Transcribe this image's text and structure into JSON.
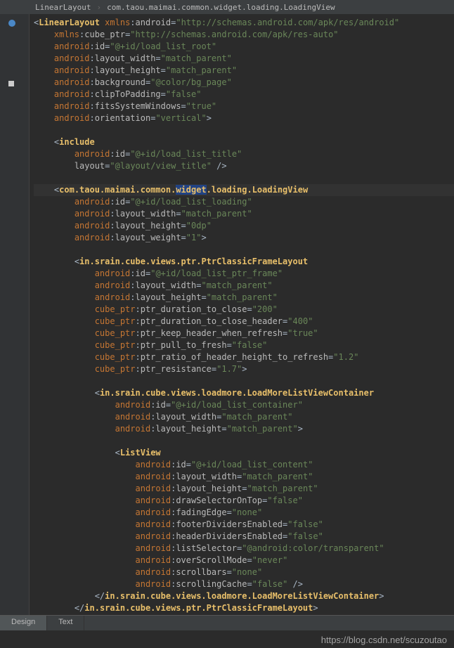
{
  "breadcrumbs": {
    "root": "LinearLayout",
    "child": "com.taou.maimai.common.widget.loading.LoadingView"
  },
  "tabs": {
    "design": "Design",
    "text": "Text"
  },
  "watermark": "https://blog.csdn.net/scuzoutao",
  "xml": {
    "root_tag": "LinearLayout",
    "root_attrs": {
      "xmlns_android": {
        "ns": "xmlns",
        "name": "android",
        "val": "http://schemas.android.com/apk/res/android"
      },
      "xmlns_cube": {
        "ns": "xmlns",
        "name": "cube_ptr",
        "val": "http://schemas.android.com/apk/res-auto"
      },
      "id": {
        "ns": "android",
        "name": "id",
        "val": "@+id/load_list_root"
      },
      "layout_width": {
        "ns": "android",
        "name": "layout_width",
        "val": "match_parent"
      },
      "layout_height": {
        "ns": "android",
        "name": "layout_height",
        "val": "match_parent"
      },
      "background": {
        "ns": "android",
        "name": "background",
        "val": "@color/bg_page"
      },
      "clipToPadding": {
        "ns": "android",
        "name": "clipToPadding",
        "val": "false"
      },
      "fitsSystemWindows": {
        "ns": "android",
        "name": "fitsSystemWindows",
        "val": "true"
      },
      "orientation": {
        "ns": "android",
        "name": "orientation",
        "val": "vertical"
      }
    },
    "include": {
      "tag": "include",
      "id": {
        "ns": "android",
        "name": "id",
        "val": "@+id/load_list_title"
      },
      "layout": {
        "ns": "",
        "name": "layout",
        "val": "@layout/view_title"
      }
    },
    "loading_view": {
      "tag_pre": "com.taou.maimai.common.",
      "tag_hl": "widget",
      "tag_post": ".loading.LoadingView",
      "id": {
        "ns": "android",
        "name": "id",
        "val": "@+id/load_list_loading"
      },
      "layout_width": {
        "ns": "android",
        "name": "layout_width",
        "val": "match_parent"
      },
      "layout_height": {
        "ns": "android",
        "name": "layout_height",
        "val": "0dp"
      },
      "layout_weight": {
        "ns": "android",
        "name": "layout_weight",
        "val": "1"
      }
    },
    "ptr": {
      "tag": "in.srain.cube.views.ptr.PtrClassicFrameLayout",
      "id": {
        "ns": "android",
        "name": "id",
        "val": "@+id/load_list_ptr_frame"
      },
      "layout_width": {
        "ns": "android",
        "name": "layout_width",
        "val": "match_parent"
      },
      "layout_height": {
        "ns": "android",
        "name": "layout_height",
        "val": "match_parent"
      },
      "dur_close": {
        "ns": "cube_ptr",
        "name": "ptr_duration_to_close",
        "val": "200"
      },
      "dur_close_header": {
        "ns": "cube_ptr",
        "name": "ptr_duration_to_close_header",
        "val": "400"
      },
      "keep_header": {
        "ns": "cube_ptr",
        "name": "ptr_keep_header_when_refresh",
        "val": "true"
      },
      "pull_to_fresh": {
        "ns": "cube_ptr",
        "name": "ptr_pull_to_fresh",
        "val": "false"
      },
      "ratio": {
        "ns": "cube_ptr",
        "name": "ptr_ratio_of_header_height_to_refresh",
        "val": "1.2"
      },
      "resistance": {
        "ns": "cube_ptr",
        "name": "ptr_resistance",
        "val": "1.7"
      }
    },
    "loadmore": {
      "tag": "in.srain.cube.views.loadmore.LoadMoreListViewContainer",
      "id": {
        "ns": "android",
        "name": "id",
        "val": "@+id/load_list_container"
      },
      "layout_width": {
        "ns": "android",
        "name": "layout_width",
        "val": "match_parent"
      },
      "layout_height": {
        "ns": "android",
        "name": "layout_height",
        "val": "match_parent"
      }
    },
    "listview": {
      "tag": "ListView",
      "id": {
        "ns": "android",
        "name": "id",
        "val": "@+id/load_list_content"
      },
      "layout_width": {
        "ns": "android",
        "name": "layout_width",
        "val": "match_parent"
      },
      "layout_height": {
        "ns": "android",
        "name": "layout_height",
        "val": "match_parent"
      },
      "drawSelectorOnTop": {
        "ns": "android",
        "name": "drawSelectorOnTop",
        "val": "false"
      },
      "fadingEdge": {
        "ns": "android",
        "name": "fadingEdge",
        "val": "none"
      },
      "footerDividersEnabled": {
        "ns": "android",
        "name": "footerDividersEnabled",
        "val": "false"
      },
      "headerDividersEnabled": {
        "ns": "android",
        "name": "headerDividersEnabled",
        "val": "false"
      },
      "listSelector": {
        "ns": "android",
        "name": "listSelector",
        "val": "@android:color/transparent"
      },
      "overScrollMode": {
        "ns": "android",
        "name": "overScrollMode",
        "val": "never"
      },
      "scrollbars": {
        "ns": "android",
        "name": "scrollbars",
        "val": "none"
      },
      "scrollingCache": {
        "ns": "android",
        "name": "scrollingCache",
        "val": "false"
      }
    }
  }
}
